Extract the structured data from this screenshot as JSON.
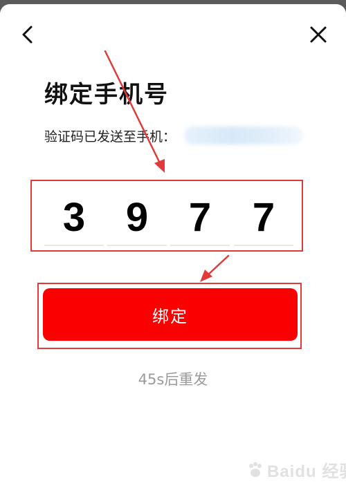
{
  "dialog": {
    "title": "绑定手机号",
    "subtitle": "验证码已发送至手机："
  },
  "code": {
    "digits": [
      "3",
      "9",
      "7",
      "7"
    ]
  },
  "bind_button": {
    "label": "绑定",
    "color": "#fb0000"
  },
  "resend": {
    "text": "45s后重发"
  },
  "icons": {
    "back": "chevron-left-icon",
    "close": "close-icon"
  },
  "annotation": {
    "highlight_color": "#e03a3a"
  },
  "watermark": {
    "text": "Baidu 经验"
  }
}
